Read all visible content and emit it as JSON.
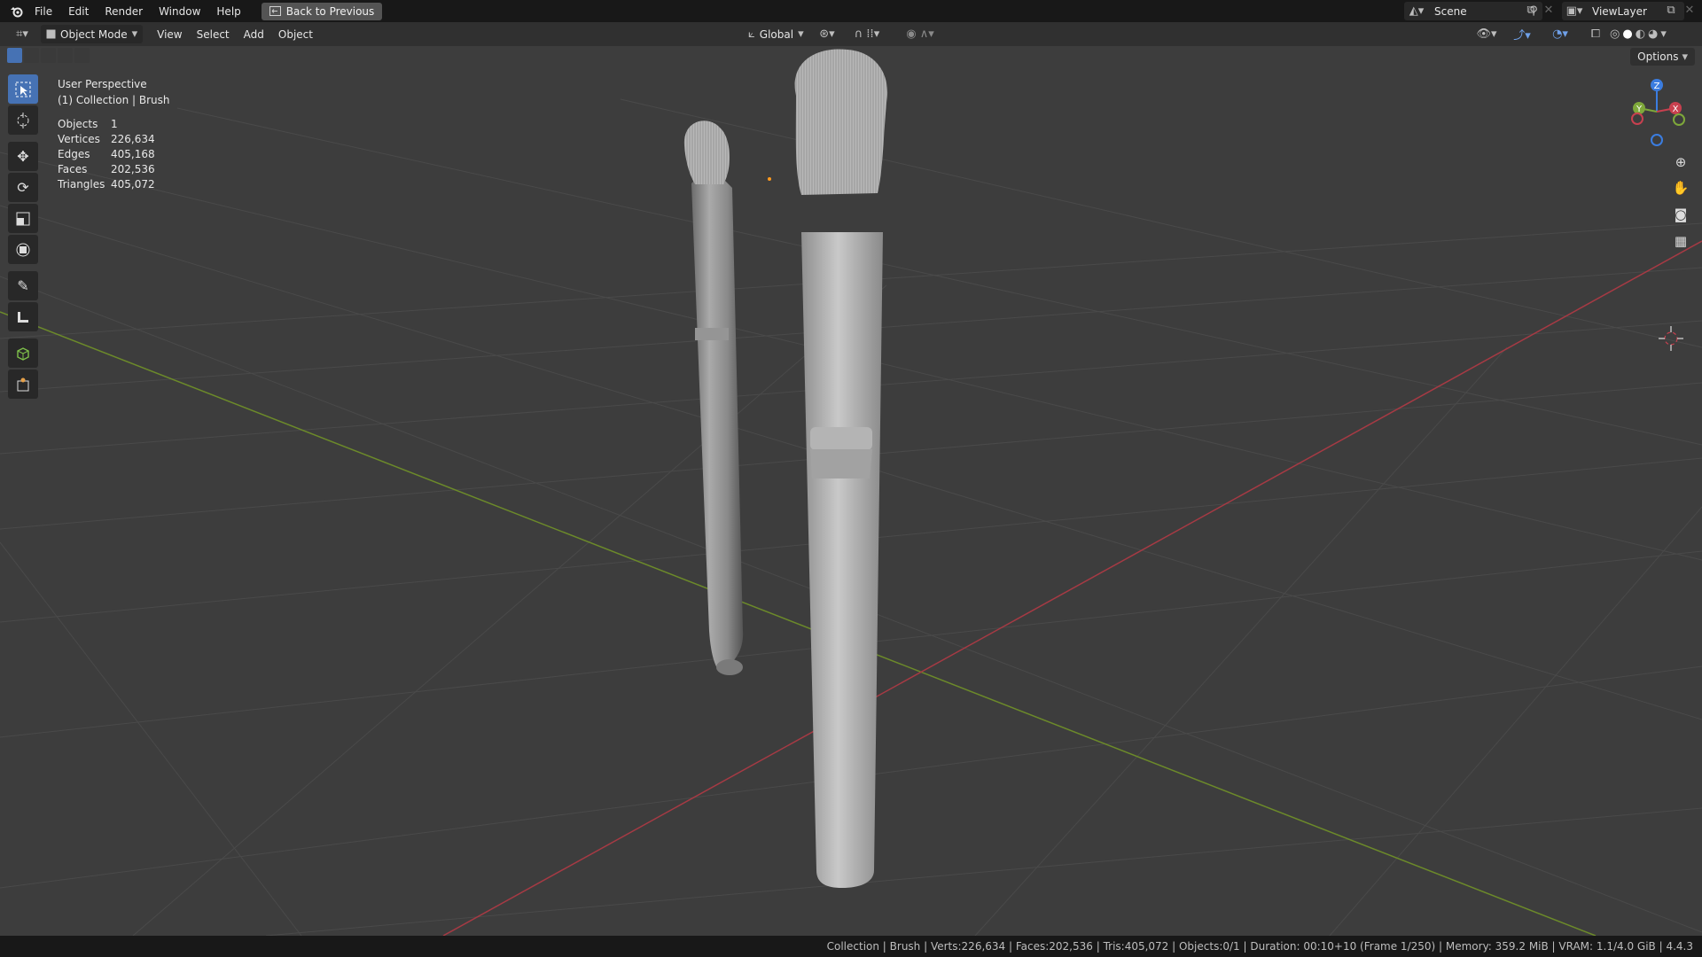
{
  "menu": {
    "file": "File",
    "edit": "Edit",
    "render": "Render",
    "window": "Window",
    "help": "Help",
    "back": "Back to Previous"
  },
  "scene": {
    "name": "Scene",
    "view_layer": "ViewLayer"
  },
  "header": {
    "mode": "Object Mode",
    "view": "View",
    "select": "Select",
    "add": "Add",
    "object": "Object",
    "orientation": "Global",
    "options": "Options"
  },
  "overlay": {
    "perspective": "User Perspective",
    "collection": "(1) Collection | Brush"
  },
  "stats": [
    {
      "label": "Objects",
      "value": "1"
    },
    {
      "label": "Vertices",
      "value": "226,634"
    },
    {
      "label": "Edges",
      "value": "405,168"
    },
    {
      "label": "Faces",
      "value": "202,536"
    },
    {
      "label": "Triangles",
      "value": "405,072"
    }
  ],
  "gizmo": {
    "x": "X",
    "y": "Y",
    "z": "Z"
  },
  "status": "Collection | Brush | Verts:226,634 | Faces:202,536 | Tris:405,072 | Objects:0/1 | Duration: 00:10+10 (Frame 1/250) | Memory: 359.2 MiB | VRAM: 1.1/4.0 GiB | 4.4.3",
  "colors": {
    "accent": "#4672b4",
    "x_axis": "#c8404f",
    "y_axis": "#7ea83a",
    "z_axis": "#3b7de0"
  },
  "icons": [
    "blender-logo",
    "back-icon",
    "scene-icon",
    "pin-icon",
    "copy-icon",
    "close-icon",
    "view-layer-icon",
    "editor-type-icon",
    "object-mode-icon",
    "transform-orientation-icon",
    "pivot-icon",
    "snap-icon",
    "proportional-icon",
    "visibility-icon",
    "gizmo-icon",
    "overlay-icon",
    "xray-icon",
    "shading-wireframe-icon",
    "shading-solid-icon",
    "shading-material-icon",
    "shading-rendered-icon",
    "select-box-icon",
    "cursor-icon",
    "move-icon",
    "rotate-icon",
    "scale-icon",
    "transform-icon",
    "annotate-icon",
    "measure-icon",
    "add-cube-icon",
    "add-mesh-icon",
    "zoom-icon",
    "pan-hand-icon",
    "camera-icon",
    "grid-icon"
  ]
}
